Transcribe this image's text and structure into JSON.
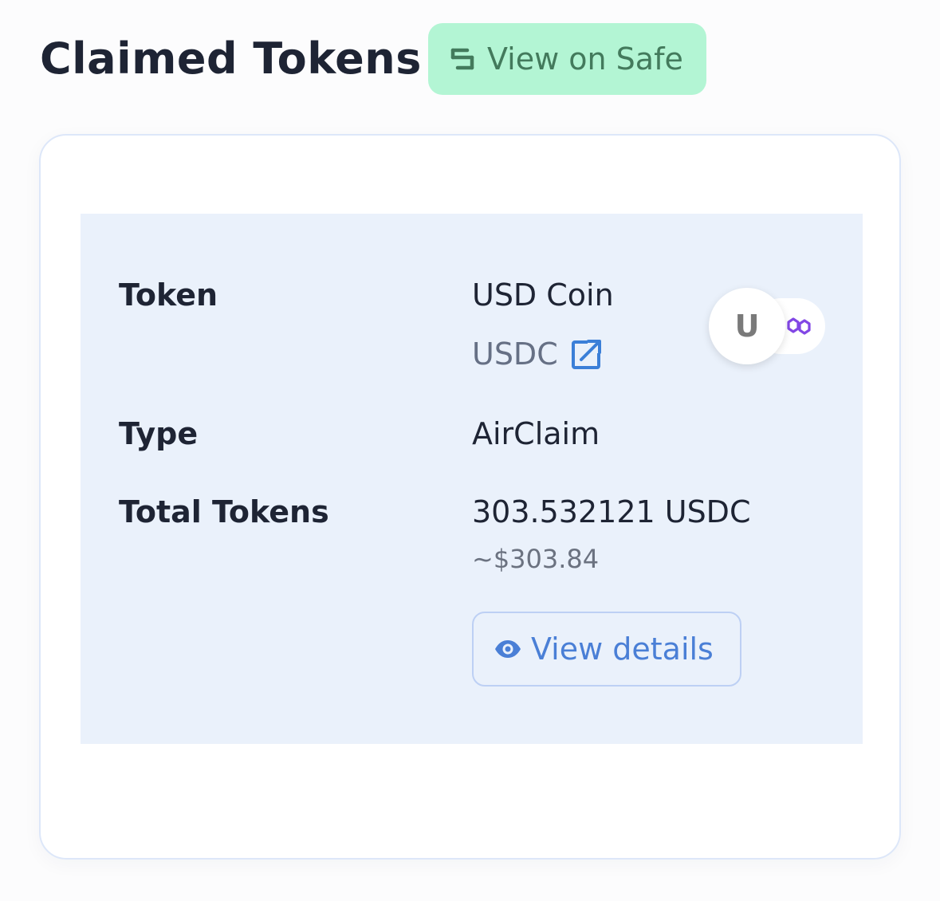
{
  "header": {
    "title": "Claimed Tokens",
    "view_on_safe_label": "View on Safe"
  },
  "card": {
    "rows": {
      "token": {
        "label": "Token",
        "name": "USD Coin",
        "symbol": "USDC",
        "avatar_letter": "U"
      },
      "type": {
        "label": "Type",
        "value": "AirClaim"
      },
      "total": {
        "label": "Total Tokens",
        "value": "303.532121 USDC",
        "usd_estimate": "~$303.84"
      }
    },
    "view_details_label": "View details"
  },
  "icons": {
    "safe": "safe-logo-icon",
    "external_link": "external-link-icon",
    "chain": "polygon-chain-icon",
    "eye": "eye-icon"
  },
  "colors": {
    "safe_button_bg": "#b3f5d4",
    "safe_button_text": "#437a5c",
    "panel_bg": "#eaf1fb",
    "link_blue": "#4a7fd6",
    "polygon_purple": "#8247e5"
  }
}
